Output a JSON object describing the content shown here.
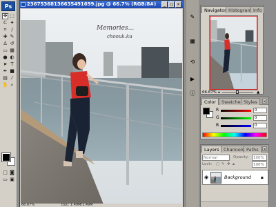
{
  "app": {
    "logo": "Ps"
  },
  "document": {
    "title": "23675368136635491699.jpg @ 66.7% (RGB/8#)",
    "watermark_line1": "Memories...",
    "watermark_line2": "choouk.ku",
    "status_zoom": "66.67%",
    "status_doc": "Doc: 1.49M/1.49M"
  },
  "navigator": {
    "tabs": [
      "Navigator",
      "Histogram",
      "Info"
    ],
    "zoom": "66.67%"
  },
  "color": {
    "tabs": [
      "Color",
      "Swatches",
      "Styles"
    ],
    "r_label": "R",
    "g_label": "G",
    "b_label": "B",
    "r_value": "0",
    "g_value": "0",
    "b_value": "0",
    "foreground": "#000000",
    "background": "#ffffff"
  },
  "layers": {
    "tabs": [
      "Layers",
      "Channels",
      "Paths"
    ],
    "blend_mode": "Normal",
    "opacity_label": "Opacity:",
    "opacity_value": "100%",
    "lock_label": "Lock:",
    "fill_value": "100%",
    "layer_name": "Background"
  },
  "toolbox": {
    "tools": [
      "move-icon",
      "marquee-icon",
      "lasso-icon",
      "magic-wand-icon",
      "crop-icon",
      "slice-icon",
      "healing-icon",
      "brush-icon",
      "stamp-icon",
      "history-brush-icon",
      "eraser-icon",
      "gradient-icon",
      "blur-icon",
      "dodge-icon",
      "path-select-icon",
      "type-icon",
      "pen-icon",
      "shape-icon",
      "notes-icon",
      "eyedropper-icon",
      "hand-icon",
      "zoom-icon"
    ]
  }
}
